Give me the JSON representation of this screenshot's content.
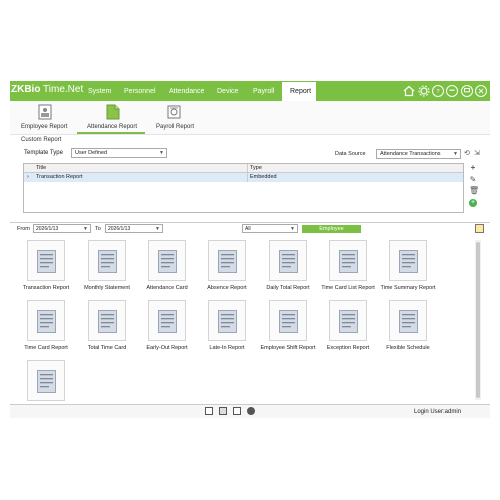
{
  "app": {
    "logo_prefix": "ZKBio",
    "logo_suffix": " Time.Net",
    "accent": "#7bc043"
  },
  "nav": {
    "items": [
      "System",
      "Personnel",
      "Attendance",
      "Device",
      "Payroll",
      "Report"
    ],
    "active": "Report"
  },
  "window_icons": [
    "home-icon",
    "settings-icon",
    "help-icon",
    "minimize-icon",
    "close-icon"
  ],
  "subnav": {
    "items": [
      "Employee Report",
      "Attendance Report",
      "Payroll Report"
    ],
    "active": "Attendance Report"
  },
  "custom_report": {
    "title": "Custom Report",
    "template_type_label": "Template Type",
    "template_type_value": "User Defined",
    "data_source_label": "Data Source",
    "data_source_value": "Attendance Transactions",
    "columns": [
      "Title",
      "Type"
    ],
    "rows": [
      {
        "marker": "›",
        "title": "Transaction Report",
        "type": "Embedded"
      }
    ],
    "side_icons": [
      "plus-icon",
      "edit-icon",
      "delete-icon",
      "add-green-icon"
    ]
  },
  "filter": {
    "from_label": "From",
    "from_value": "2026/1/13",
    "to_label": "To",
    "to_value": "2026/1/13",
    "scope_value": "All",
    "employee_button": "Employee"
  },
  "reports": [
    "Transaction Report",
    "Monthly Statement",
    "Attendance Card",
    "Absence Report",
    "Daily Total Report",
    "Time Card List Report",
    "Time Summary Report",
    "Time Card Report",
    "Total Time Card",
    "Early-Out Report",
    "Late-In Report",
    "Employee Shift Report",
    "Exception Report",
    "Flexible Schedule",
    ""
  ],
  "status": {
    "login_text": "Login User:admin",
    "icons": [
      "card-icon",
      "report-icon",
      "copy-icon",
      "pie-icon"
    ]
  }
}
